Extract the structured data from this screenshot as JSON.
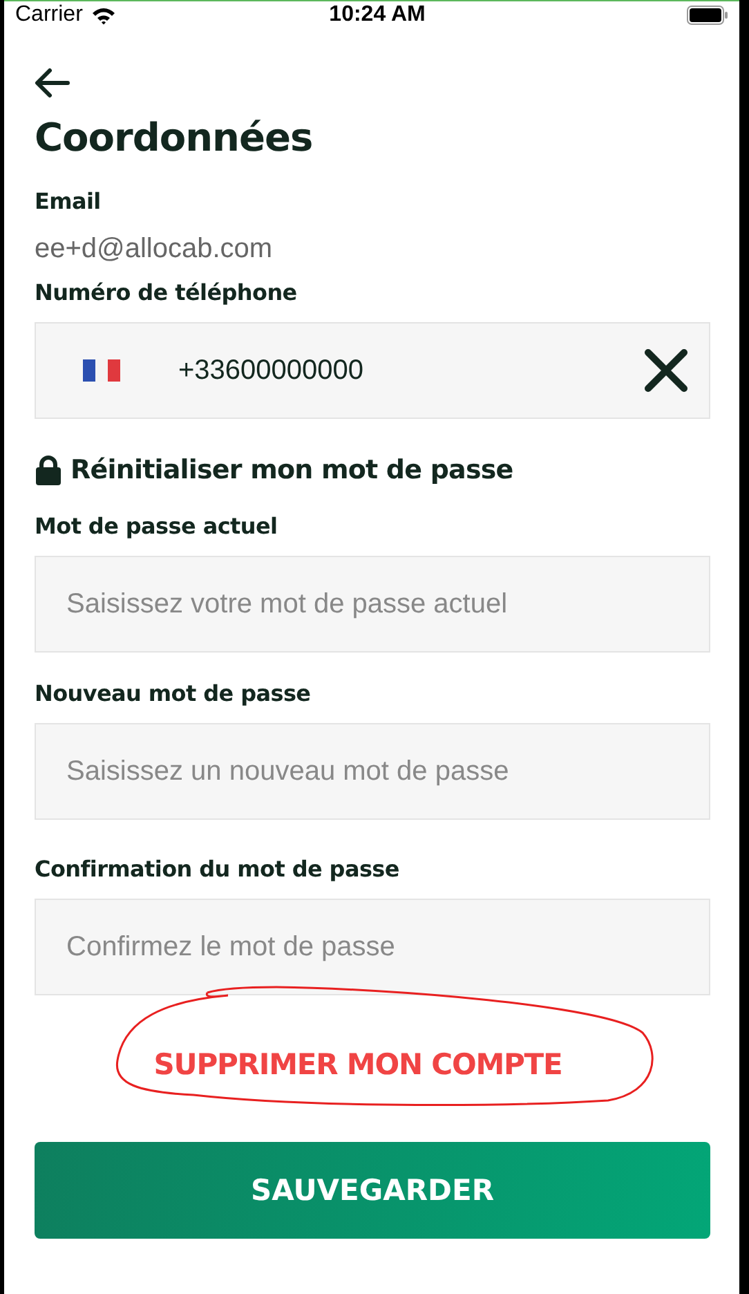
{
  "status_bar": {
    "carrier": "Carrier",
    "time": "10:24 AM"
  },
  "title": "Coordonnées",
  "email": {
    "label": "Email",
    "value": "ee+d@allocab.com"
  },
  "phone": {
    "label": "Numéro de téléphone",
    "value": "+33600000000"
  },
  "password_section": {
    "title": "Réinitialiser mon mot de passe",
    "fields": [
      {
        "label": "Mot de passe actuel",
        "placeholder": "Saisissez votre mot de passe actuel"
      },
      {
        "label": "Nouveau mot de passe",
        "placeholder": "Saisissez un nouveau mot de passe"
      },
      {
        "label": "Confirmation du mot de passe",
        "placeholder": "Confirmez le mot de passe"
      }
    ]
  },
  "delete_button": "SUPPRIMER MON COMPTE",
  "save_button": "SAUVEGARDER"
}
